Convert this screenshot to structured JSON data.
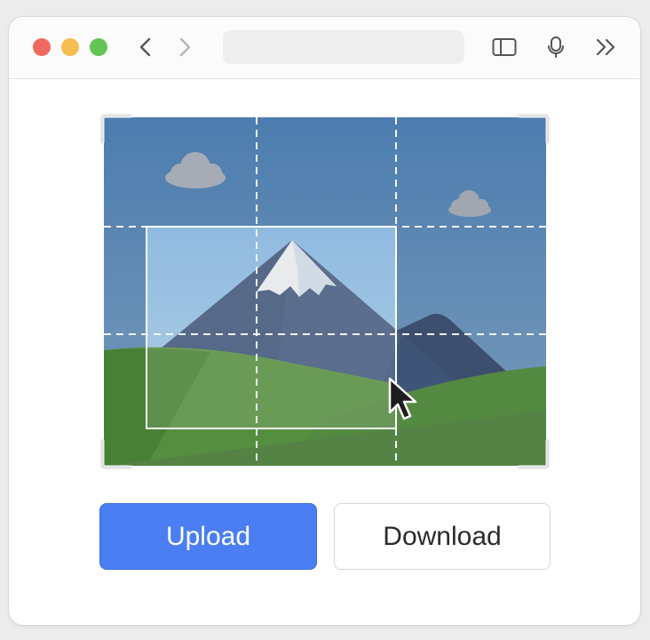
{
  "window": {
    "toolbar": {
      "url_text": "",
      "icons": {
        "back": "chevron-left-icon",
        "forward": "chevron-right-icon",
        "sidebar": "sidebar-icon",
        "mic": "microphone-icon",
        "more": "double-chevron-right-icon"
      }
    }
  },
  "editor": {
    "image_subject": "mountain-landscape",
    "crop_grid": "rule-of-thirds"
  },
  "actions": {
    "upload_label": "Upload",
    "download_label": "Download"
  },
  "colors": {
    "primary": "#4a7ef2",
    "close": "#ee6a5f",
    "minimize": "#f5be4f",
    "zoom": "#62c554"
  }
}
